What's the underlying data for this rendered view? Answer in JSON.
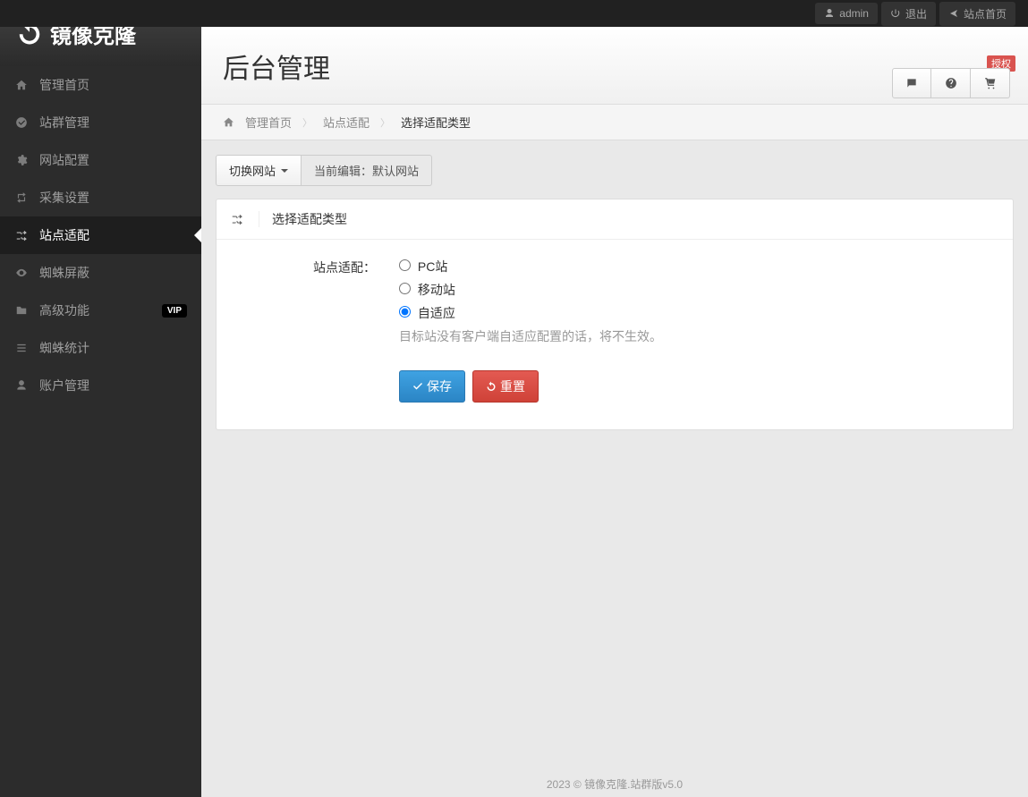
{
  "topbar": {
    "user": "admin",
    "logout": "退出",
    "site_home": "站点首页"
  },
  "brand": {
    "name": "镜像克隆"
  },
  "sidebar": {
    "items": [
      {
        "label": "管理首页",
        "icon": "home"
      },
      {
        "label": "站群管理",
        "icon": "check-circle"
      },
      {
        "label": "网站配置",
        "icon": "gear"
      },
      {
        "label": "采集设置",
        "icon": "retweet"
      },
      {
        "label": "站点适配",
        "icon": "shuffle",
        "active": true
      },
      {
        "label": "蜘蛛屏蔽",
        "icon": "eye"
      },
      {
        "label": "高级功能",
        "icon": "folder",
        "badge": "VIP"
      },
      {
        "label": "蜘蛛统计",
        "icon": "list"
      },
      {
        "label": "账户管理",
        "icon": "user"
      }
    ]
  },
  "page": {
    "title": "后台管理",
    "auth_badge": "授权"
  },
  "breadcrumb": {
    "items": [
      "管理首页",
      "站点适配",
      "选择适配类型"
    ]
  },
  "site_bar": {
    "switch_label": "切换网站",
    "editing_label": "当前编辑：",
    "current_site": "默认网站"
  },
  "panel": {
    "title": "选择适配类型",
    "form": {
      "label": "站点适配：",
      "options": [
        {
          "label": "PC站",
          "value": "pc",
          "checked": false
        },
        {
          "label": "移动站",
          "value": "mobile",
          "checked": false
        },
        {
          "label": "自适应",
          "value": "responsive",
          "checked": true
        }
      ],
      "help": "目标站没有客户端自适应配置的话，将不生效。",
      "save_label": "保存",
      "reset_label": "重置"
    }
  },
  "footer": "2023 © 镜像克隆.站群版v5.0"
}
